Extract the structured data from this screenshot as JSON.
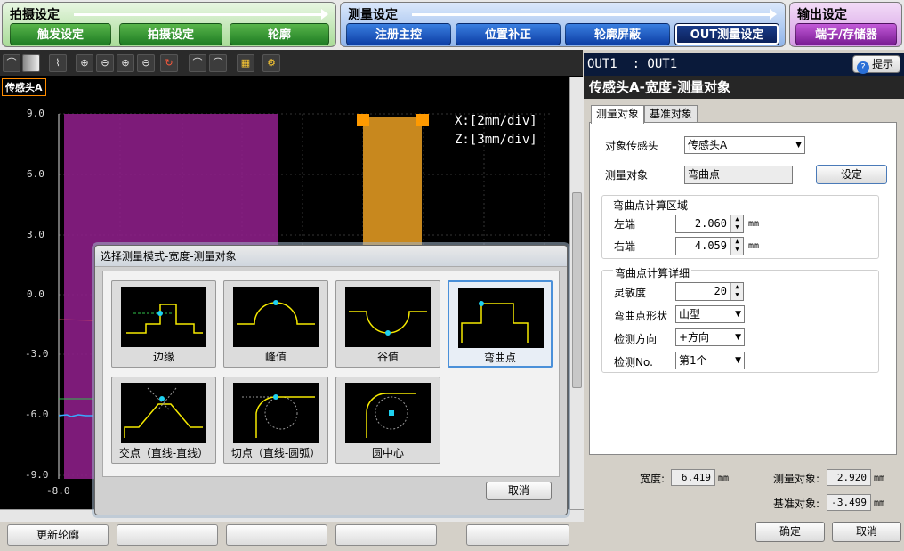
{
  "workflow": {
    "groups": [
      {
        "title": "拍摄设定",
        "buttons": [
          "触发设定",
          "拍摄设定",
          "轮廓"
        ]
      },
      {
        "title": "测量设定",
        "buttons": [
          "注册主控",
          "位置补正",
          "轮廓屏蔽",
          "OUT测量设定"
        ]
      },
      {
        "title": "输出设定",
        "buttons": [
          "端子/存储器"
        ]
      }
    ]
  },
  "graph": {
    "sensor_tag": "传感头A",
    "y_ticks": [
      "9.0",
      "6.0",
      "3.0",
      "0.0",
      "-3.0",
      "-6.0",
      "-9.0"
    ],
    "x_tick_start": "-8.0",
    "x_scale": "X:[2mm/div]",
    "z_scale": "Z:[3mm/div]"
  },
  "bottom": {
    "update_profile": "更新轮廓"
  },
  "right_panel": {
    "out_label": "OUT1  : OUT1",
    "help": "提示",
    "title": "传感头A-宽度-测量对象",
    "tabs": [
      "测量对象",
      "基准对象"
    ],
    "target_sensor_label": "对象传感头",
    "target_sensor_value": "传感头A",
    "measure_target_label": "测量对象",
    "measure_target_value": "弯曲点",
    "set_button": "设定",
    "area_group": "弯曲点计算区域",
    "left_label": "左端",
    "left_value": "2.060",
    "right_label": "右端",
    "right_value": "4.059",
    "mm": "mm",
    "detail_group": "弯曲点计算详细",
    "sensitivity_label": "灵敏度",
    "sensitivity_value": "20",
    "shape_label": "弯曲点形状",
    "shape_value": "山型",
    "direction_label": "检测方向",
    "direction_value": "+方向",
    "detect_no_label": "检测No.",
    "detect_no_value": "第1个",
    "width_label": "宽度:",
    "width_value": "6.419",
    "measure_obj_label": "测量对象:",
    "measure_obj_value": "2.920",
    "base_obj_label": "基准对象:",
    "base_obj_value": "-3.499",
    "ok": "确定",
    "cancel": "取消"
  },
  "dialog": {
    "title": "选择测量模式-宽度-测量对象",
    "options": [
      "边缘",
      "峰值",
      "谷值",
      "弯曲点",
      "交点（直线-直线）",
      "切点（直线-圆弧）",
      "圆中心"
    ],
    "selected": "弯曲点",
    "cancel": "取消"
  }
}
